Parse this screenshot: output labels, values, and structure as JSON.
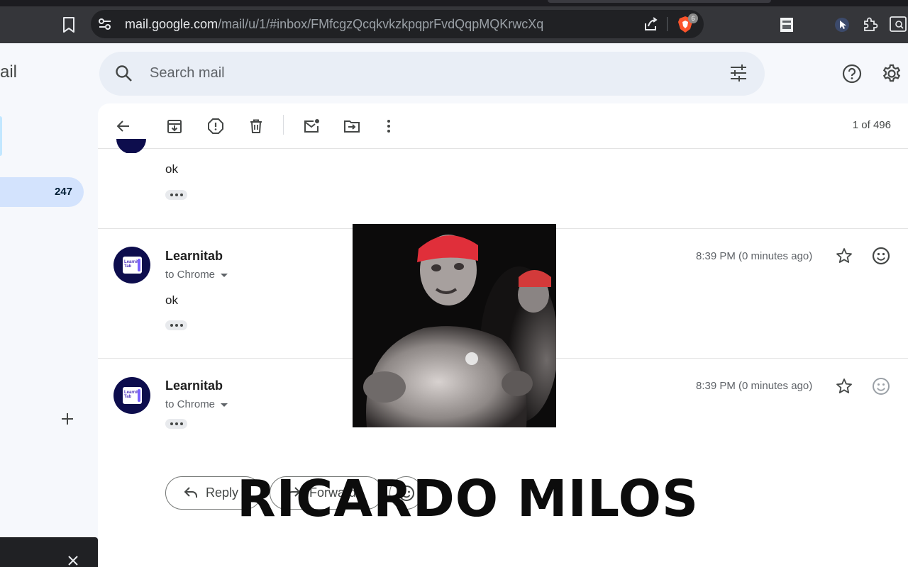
{
  "browser": {
    "url_host": "mail.google.com",
    "url_path": "/mail/u/1/#inbox/FMfcgzQcqkvkzkpqprFvdQqpMQKrwcXq",
    "brave_badge_count": "6",
    "icons": [
      "bookmark-icon",
      "site-settings-icon",
      "share-icon",
      "brave-shield-icon",
      "extension-icon",
      "puzzle-icon",
      "side-panel-icon"
    ]
  },
  "gmail": {
    "logo_fragment": "ail",
    "search": {
      "placeholder": "Search mail"
    },
    "sidebar": {
      "inbox_count": "247"
    },
    "toolbar": {
      "pager": "1 of 496"
    }
  },
  "messages": [
    {
      "body": "ok"
    },
    {
      "sender": "Learnitab",
      "recipient": "to Chrome",
      "timestamp": "8:39 PM (0 minutes ago)",
      "body": "ok",
      "avatar_text": "Learnit\nTab"
    },
    {
      "sender": "Learnitab",
      "recipient": "to Chrome",
      "timestamp": "8:39 PM (0 minutes ago)",
      "avatar_text": "Learnit\nTab"
    }
  ],
  "actions": {
    "reply": "Reply",
    "forward": "Forward"
  },
  "overlay": {
    "caption": "RICARDO MILOS"
  },
  "colors": {
    "accent": "#0b57d0",
    "inbox_highlight": "#d3e3fd",
    "search_bg": "#e9eef6",
    "chrome_bg": "#35363a",
    "avatar_bg": "#0d0d4d"
  }
}
